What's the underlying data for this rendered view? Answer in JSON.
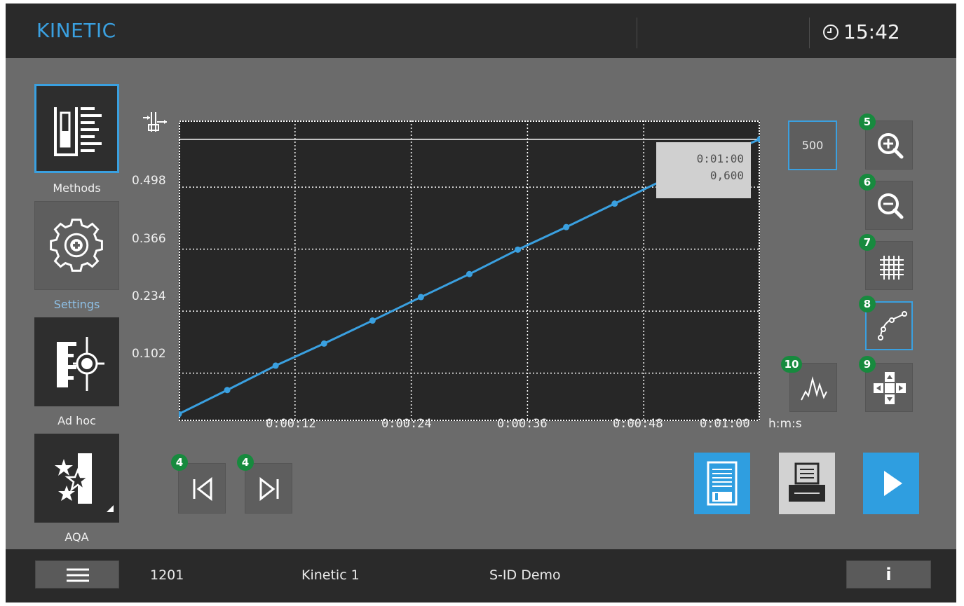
{
  "header": {
    "title": "KINETIC",
    "time": "15:42"
  },
  "sidebar": {
    "items": [
      {
        "label": "Methods",
        "icon": "methods-icon",
        "selected": true
      },
      {
        "label": "Settings",
        "icon": "gear-icon",
        "selected": false
      },
      {
        "label": "Ad hoc",
        "icon": "ad-hoc-icon",
        "selected": false
      },
      {
        "label": "AQA",
        "icon": "aqa-icon",
        "selected": false
      }
    ]
  },
  "chart_data": {
    "type": "line",
    "x_unit": "h:m:s",
    "x_tick_labels": [
      "0:00:12",
      "0:00:24",
      "0:00:36",
      "0:00:48",
      "0:01:00"
    ],
    "y_tick_labels": [
      "0.498",
      "0.366",
      "0.234",
      "0.102"
    ],
    "y_ticks": [
      0.498,
      0.366,
      0.234,
      0.102
    ],
    "x_range_seconds": [
      0,
      60
    ],
    "y_range": [
      0,
      0.64
    ],
    "series": [
      {
        "color": "#3aa0e0",
        "x_seconds": [
          0,
          5,
          10,
          15,
          20,
          25,
          30,
          35,
          40,
          45,
          50,
          55,
          60
        ],
        "y": [
          0.015,
          0.066,
          0.118,
          0.165,
          0.214,
          0.264,
          0.313,
          0.365,
          0.413,
          0.463,
          0.513,
          0.558,
          0.6
        ]
      }
    ],
    "cursor": {
      "time": "0:01:00",
      "value": "0,600",
      "y_line": 0.6
    },
    "grid": true
  },
  "controls": {
    "range_value": "500",
    "badges": {
      "zoom_in": "5",
      "zoom_out": "6",
      "grid": "7",
      "curve": "8",
      "pan": "9",
      "peak": "10",
      "prev": "4",
      "next": "4"
    }
  },
  "footer": {
    "method_number": "1201",
    "method_name": "Kinetic 1",
    "sample_id": "S-ID Demo",
    "info_label": "i"
  },
  "colors": {
    "accent": "#3aa0e0",
    "badge": "#178a3e"
  }
}
